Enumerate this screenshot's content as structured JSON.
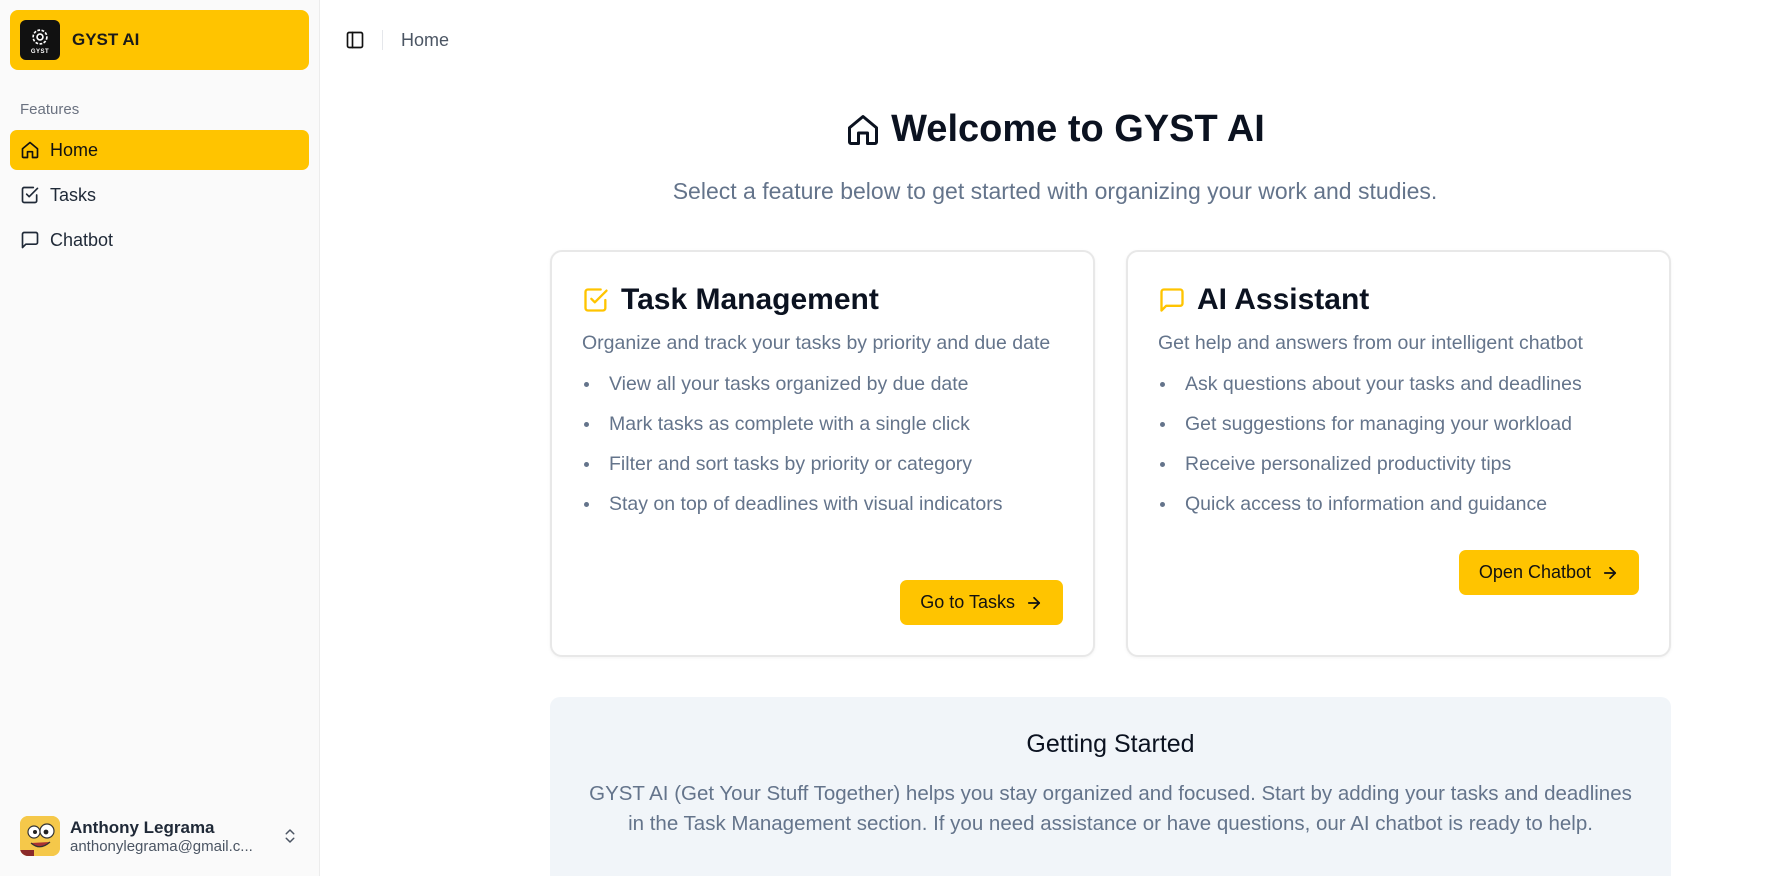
{
  "brand": {
    "name": "GYST AI",
    "logo_text": "GYST"
  },
  "sidebar": {
    "section_label": "Features",
    "items": [
      {
        "label": "Home",
        "icon": "home-icon",
        "active": true
      },
      {
        "label": "Tasks",
        "icon": "check-square-icon",
        "active": false
      },
      {
        "label": "Chatbot",
        "icon": "message-square-icon",
        "active": false
      }
    ]
  },
  "user": {
    "name": "Anthony Legrama",
    "email": "anthonylegrama@gmail.c..."
  },
  "topbar": {
    "breadcrumb": "Home"
  },
  "hero": {
    "title": "Welcome to GYST AI",
    "subtitle": "Select a feature below to get started with organizing your work and studies."
  },
  "cards": {
    "tasks": {
      "title": "Task Management",
      "description": "Organize and track your tasks by priority and due date",
      "bullets": [
        "View all your tasks organized by due date",
        "Mark tasks as complete with a single click",
        "Filter and sort tasks by priority or category",
        "Stay on top of deadlines with visual indicators"
      ],
      "button": "Go to Tasks"
    },
    "chat": {
      "title": "AI Assistant",
      "description": "Get help and answers from our intelligent chatbot",
      "bullets": [
        "Ask questions about your tasks and deadlines",
        "Get suggestions for managing your workload",
        "Receive personalized productivity tips",
        "Quick access to information and guidance"
      ],
      "button": "Open Chatbot"
    }
  },
  "getting_started": {
    "title": "Getting Started",
    "body": "GYST AI (Get Your Stuff Together) helps you stay organized and focused. Start by adding your tasks and deadlines in the Task Management section. If you need assistance or have questions, our AI chatbot is ready to help."
  },
  "colors": {
    "accent": "#ffc400",
    "muted_text": "#64748b",
    "sidebar_bg": "#fafafa",
    "panel_bg": "#f1f5f9"
  }
}
